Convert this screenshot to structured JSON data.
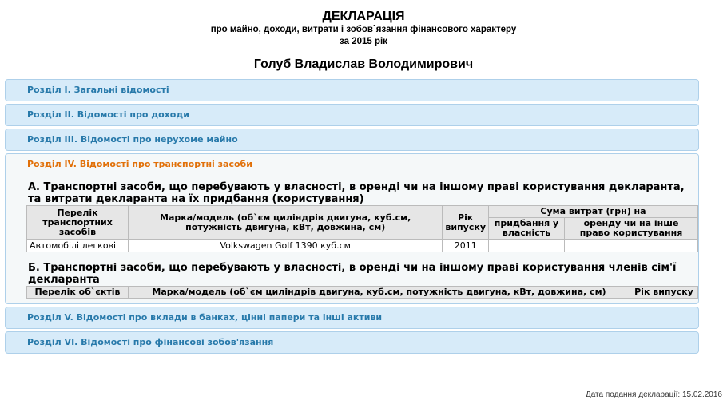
{
  "header": {
    "title": "ДЕКЛАРАЦІЯ",
    "subtitle": "про майно, доходи, витрати і зобов`язання фінансового характеру",
    "year_line": "за 2015 рік",
    "person": "Голуб Владислав Володимирович"
  },
  "sections": {
    "s1": "Розділ І. Загальні відомості",
    "s2": "Розділ ІІ. Відомості про доходи",
    "s3": "Розділ ІІІ. Відомості про нерухоме майно",
    "s4": "Розділ IV. Відомості про транспортні засоби",
    "s5": "Розділ V. Відомості про вклади в банках, цінні папери та інші активи",
    "s6": "Розділ VI. Відомості про фінансові зобов'язання"
  },
  "vehicles_a": {
    "heading": "А. Транспортні засоби, що перебувають у власності, в оренді чи на іншому праві користування декларанта, та витрати декларанта на їх придбання (користування)",
    "col_list": "Перелік транспортних засобів",
    "col_model": "Марка/модель (об`єм циліндрів двигуна, куб.см, потужність двигуна, кВт, довжина, см)",
    "col_year": "Рік випуску",
    "col_sum": "Сума витрат (грн) на",
    "col_purchase": "придбання у власність",
    "col_rent": "оренду чи на інше право користування",
    "rows": [
      {
        "type": "Автомобілі легкові",
        "model": "Volkswagen Golf 1390 куб.см",
        "year": "2011",
        "purchase": "",
        "rent": ""
      }
    ]
  },
  "vehicles_b": {
    "heading": "Б. Транспортні засоби, що перебувають у власності, в оренді чи на іншому праві користування членів сім'ї декларанта",
    "col_list": "Перелік об`єктів",
    "col_model": "Марка/модель (об`єм циліндрів двигуна, куб.см, потужність двигуна, кВт, довжина, см)",
    "col_year": "Рік випуску"
  },
  "footer": {
    "date": "Дата подання декларації: 15.02.2016"
  }
}
